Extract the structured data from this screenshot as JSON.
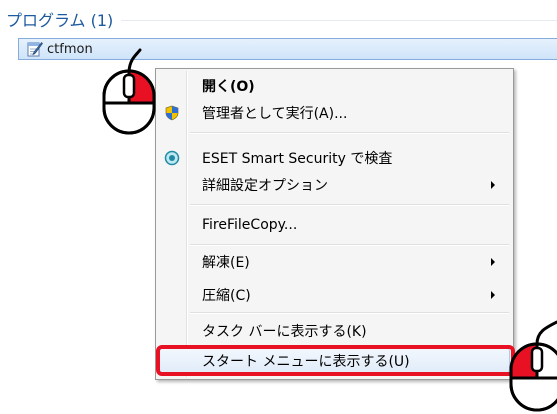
{
  "group": {
    "title": "プログラム (1)"
  },
  "result": {
    "label": "ctfmon",
    "icon": "notepad-icon"
  },
  "context_menu": {
    "items": [
      {
        "label": "開く(O)",
        "bold": true,
        "icon": ""
      },
      {
        "label": "管理者として実行(A)...",
        "icon": "uac-shield-icon"
      },
      {
        "label": "ESET Smart Security で検査",
        "icon": "eset-icon"
      },
      {
        "label": "詳細設定オプション",
        "submenu": true
      },
      {
        "label": "FireFileCopy..."
      },
      {
        "label": "解凍(E)",
        "submenu": true
      },
      {
        "label": "圧縮(C)",
        "submenu": true
      },
      {
        "label": "タスク バーに表示する(K)"
      },
      {
        "label": "スタート メニューに表示する(U)",
        "highlighted": true
      }
    ]
  },
  "annotations": {
    "right_click_mouse_icon": "mouse-right-click-icon",
    "left_click_mouse_icon": "mouse-left-click-icon",
    "highlight_color": "#e81123"
  }
}
